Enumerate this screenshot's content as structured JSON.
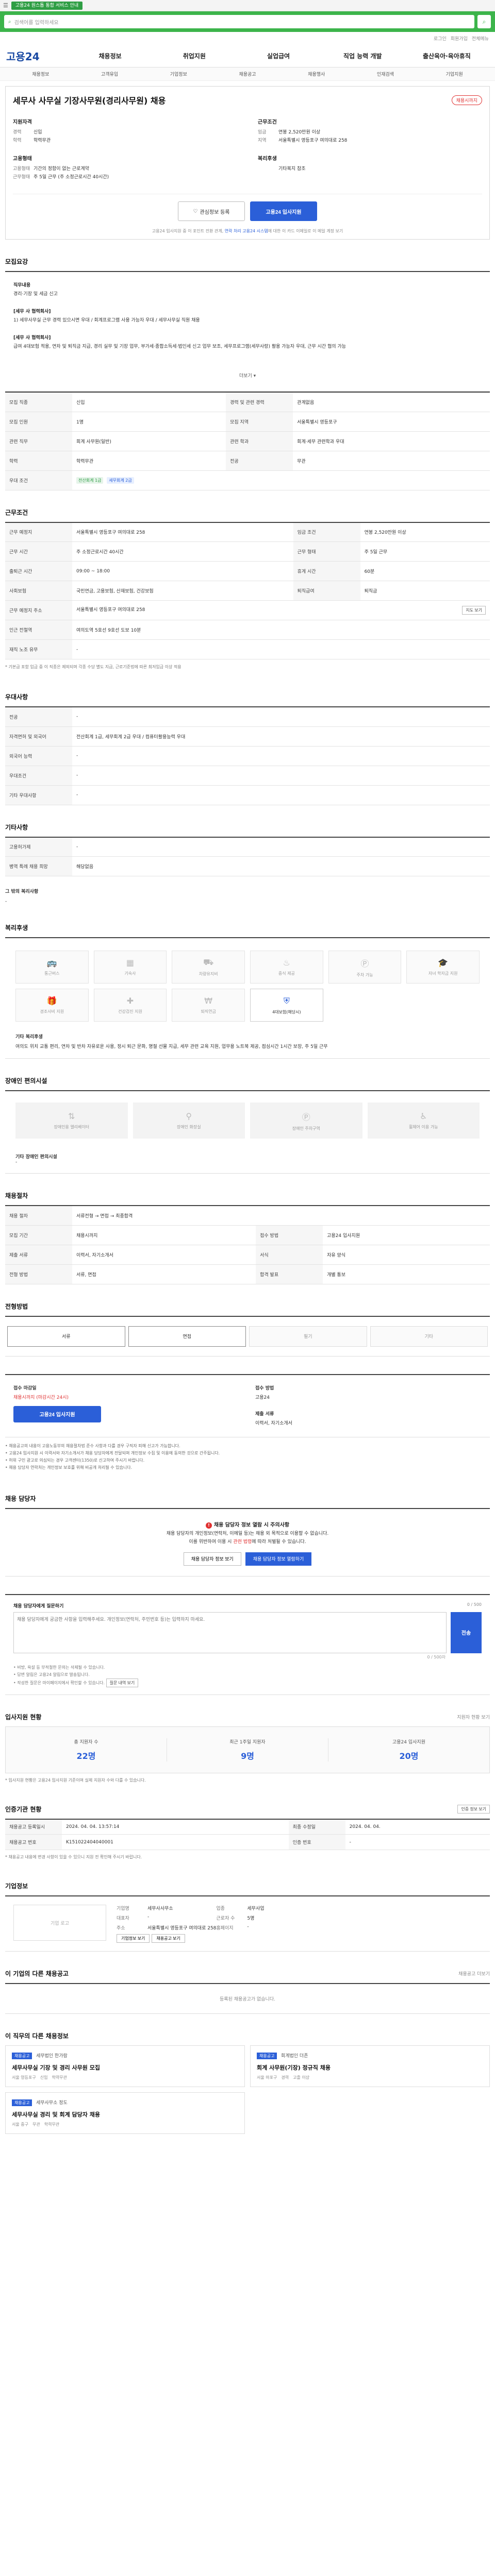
{
  "topbar": {
    "menu_icon": "menu-icon",
    "notice": "고용24 원스톱 통합 서비스 안내",
    "right": ""
  },
  "banner": {
    "search_placeholder": "검색어를 입력하세요",
    "search_icon": "search-icon"
  },
  "util": {
    "links": [
      "로그인",
      "회원가입",
      "전체메뉴"
    ]
  },
  "gnb": {
    "logo": "고용24",
    "items": [
      "채용정보",
      "취업지원",
      "실업급여",
      "직업 능력 개발",
      "출산육아·육아휴직"
    ]
  },
  "subnav": {
    "items": [
      "채용정보",
      "고객유입",
      "기업정보",
      "채용공고",
      "채용행사",
      "인재검색",
      "기업지원"
    ]
  },
  "job": {
    "title": "세무사 사무실 기장사무원(경리사무원) 채용",
    "badge": "채용시까지",
    "left": [
      {
        "title": "지원자격",
        "rows": [
          {
            "k": "경력",
            "v": "신입"
          },
          {
            "k": "학력",
            "v": "학력무관"
          }
        ]
      },
      {
        "title": "고용형태",
        "rows": [
          {
            "k": "고용형태",
            "v": "기간의 정함이 없는 근로계약"
          },
          {
            "k": "근무형태",
            "v": "주 5일 근무 (주 소정근로시간 40시간)"
          }
        ]
      }
    ],
    "right": [
      {
        "title": "근무조건",
        "rows": [
          {
            "k": "임금",
            "v": "연봉 2,520만원 이상"
          },
          {
            "k": "지역",
            "v": "서울특별시 영등포구 여의대로 258"
          }
        ]
      },
      {
        "title": "복리후생",
        "rows": [
          {
            "k": "",
            "v": "기타복지 참조"
          }
        ]
      }
    ],
    "save_label": "관심정보 등록",
    "apply_label": "고용24 입사지원",
    "note_prefix": "고용24 입사지원 중 이 포인트 전환 관계, ",
    "note_highlight": "연락 처리 고용24 시스템",
    "note_suffix": "에 대한 이 카드 이메일로 이 메일 계정 보기"
  },
  "detail": {
    "section_title": "모집요강",
    "blocks": [
      {
        "dt": "직무내용",
        "dd": "경리·기장 및 세금 신고"
      },
      {
        "dt": "[세무 사 협력회사]",
        "dd": "1) 세무사무실 근무 경력 있으시면 우대 / 회계프로그램 사용 가능자 우대 / 세무사무실 직원 채용"
      },
      {
        "dt": "[세무 사 협력회사]",
        "dd": "급여 4대보험 적용, 연차 및 퇴직금 지급, 경리 실무 및 기장 업무, 부가세·종합소득세·법인세 신고 업무 보조, 세무프로그램(세무사랑) 활용 가능자 우대, 근무 시간 협의 가능"
      }
    ],
    "more_label": "더보기 ▾",
    "table": [
      {
        "k": "모집 직종",
        "v": "신입",
        "k2": "경력 및 관련 경력",
        "v2": "관계없음"
      },
      {
        "k": "모집 인원",
        "v": "1명",
        "k2": "모집 지역",
        "v2": "서울특별시 영등포구"
      },
      {
        "k": "관련 직무",
        "v": "회계 사무원(일반)",
        "k2": "관련 학과",
        "v2": "회계·세무 관련학과 우대"
      },
      {
        "k": "학력",
        "v": "학력무관",
        "k2": "전공",
        "v2": "무관"
      }
    ],
    "tags_label": "우대 조건",
    "tags_green": "전산회계 1급",
    "tags_blue": "세무회계 2급"
  },
  "work": {
    "section_title": "근무조건",
    "rows": [
      {
        "k": "근무 예정지",
        "v": "서울특별시 영등포구 여의대로 258",
        "k2": "임금 조건",
        "v2": "연봉 2,520만원 이상"
      },
      {
        "k": "근무 시간",
        "v": "주 소정근로시간 40시간",
        "k2": "근무 형태",
        "v2": "주 5일 근무"
      },
      {
        "k": "출퇴근 시간",
        "v": "09:00 ~ 18:00",
        "k2": "휴게 시간",
        "v2": "60분"
      },
      {
        "k": "사회보험",
        "v": "국민연금, 고용보험, 산재보험, 건강보험",
        "k2": "퇴직급여",
        "v2": "퇴직금"
      },
      {
        "k": "근무 예정지 주소",
        "v": "서울특별시 영등포구 여의대로 258",
        "k2": "",
        "v2": ""
      },
      {
        "k": "인근 전철역",
        "v": "여의도역 5호선 9호선 도보 10분",
        "k2": "",
        "v2": ""
      },
      {
        "k": "재직 노조 유무",
        "v": "-",
        "k2": "",
        "v2": ""
      }
    ],
    "map_btn": "지도 보기",
    "footnote": "* 기본급 포함 임금 중 이 직종은 제외되며 각종 수당 별도 지급, 근로기준법에 따른 최저임금 이상 적용"
  },
  "apply_conditions": {
    "section_title": "우대사항",
    "rows": [
      {
        "k": "전공",
        "v": "-"
      },
      {
        "k": "자격면허 및 외국어",
        "v": "전산회계 1급, 세무회계 2급 우대 / 컴퓨터활용능력 우대"
      },
      {
        "k": "외국어 능력",
        "v": "-"
      },
      {
        "k": "우대조건",
        "v": "-"
      },
      {
        "k": "기타 우대사항",
        "v": "-"
      }
    ]
  },
  "other": {
    "section_title": "기타사항",
    "rows": [
      {
        "k": "고용허가제",
        "v": "-"
      },
      {
        "k": "병역 특례 채용 희망",
        "v": "해당없음"
      }
    ],
    "etc_title": "그 밖의 복리사항",
    "etc_text": "-"
  },
  "welfare": {
    "section_title": "복리후생",
    "items": [
      {
        "label": "통근버스",
        "icon": "bus-icon",
        "on": false
      },
      {
        "label": "기숙사",
        "icon": "building-icon",
        "on": false
      },
      {
        "label": "차량유지비",
        "icon": "car-icon",
        "on": false
      },
      {
        "label": "중식 제공",
        "icon": "meal-icon",
        "on": false
      },
      {
        "label": "주차 가능",
        "icon": "parking-icon",
        "on": false
      },
      {
        "label": "자녀 학자금 지원",
        "icon": "graduation-icon",
        "on": false
      },
      {
        "label": "경조사비 지원",
        "icon": "gift-icon",
        "on": false
      },
      {
        "label": "건강검진 지원",
        "icon": "health-icon",
        "on": false
      },
      {
        "label": "퇴직연금",
        "icon": "pension-icon",
        "on": false
      },
      {
        "label": "4대보험(해당시)",
        "icon": "shield-icon",
        "on": true
      }
    ],
    "sub_title": "기타 복리후생",
    "sub_text": "여의도 위치 교통 편리, 연차 및 반차 자유로운 사용, 정시 퇴근 문화, 명절 선물 지급, 세무 관련 교육 지원, 업무용 노트북 제공, 점심시간 1시간 보장, 주 5일 근무"
  },
  "access": {
    "section_title": "장애인 편의시설",
    "items": [
      {
        "label": "장애인용 엘리베이터",
        "icon": "elevator-icon"
      },
      {
        "label": "장애인 화장실",
        "icon": "restroom-icon"
      },
      {
        "label": "장애인 주차구역",
        "icon": "parking-icon"
      },
      {
        "label": "휠체어 이용 가능",
        "icon": "wheelchair-icon"
      }
    ],
    "sub_title": "기타 장애인 편의시설",
    "sub_text": "-"
  },
  "recruit": {
    "section_title": "채용절차",
    "rows": [
      {
        "k": "채용 절차",
        "v": "서류전형 → 면접 → 최종합격",
        "k2": "",
        "v2": ""
      },
      {
        "k": "모집 기간",
        "v": "채용시까지",
        "k2": "접수 방법",
        "v2": "고용24 입사지원"
      },
      {
        "k": "제출 서류",
        "v": "이력서, 자기소개서",
        "k2": "서식",
        "v2": "자유 양식"
      },
      {
        "k": "전형 방법",
        "v": "서류, 면접",
        "k2": "합격 발표",
        "v2": "개별 통보"
      }
    ]
  },
  "process": {
    "section_title": "전형방법",
    "items": [
      {
        "label": "서류",
        "on": true
      },
      {
        "label": "면접",
        "on": true
      },
      {
        "label": "필기",
        "on": false
      },
      {
        "label": "기타",
        "on": false
      }
    ]
  },
  "howto": {
    "col1_title": "접수 마감일",
    "col1_value": "채용시까지 (마감시간 24시)",
    "col1_btn": "고용24 입사지원",
    "col2_title": "접수 방법",
    "col2_value": "고용24",
    "col3_title": "제출 서류",
    "col3_value": "이력서, 자기소개서"
  },
  "notes": {
    "lines": [
      "• 채용공고의 내용이 고용노동부의 채용절차법 준수 사항과 다를 경우 구직자 피해 신고가 가능합니다.",
      "• 고용24 입사지원 시 이력서와 자기소개서가 채용 담당자에게 전달되며 개인정보 수집 및 이용에 동의한 것으로 간주됩니다.",
      "• 허위 구인 광고로 의심되는 경우 고객센터(1350)로 신고하여 주시기 바랍니다.",
      "• 채용 담당자 연락처는 개인정보 보호를 위해 비공개 처리될 수 있습니다."
    ]
  },
  "contact": {
    "section_title": "채용 담당자",
    "warn": "채용 담당자 정보 열람 시 주의사항",
    "line1": "채용 담당자의 개인정보(연락처, 이메일 등)는 채용 외 목적으로 이용할 수 없습니다.",
    "line2_prefix": "이를 위반하여 이용 시 ",
    "line2_red": "관련 법령",
    "line2_suffix": "에 따라 처벌될 수 있습니다.",
    "btn_view": "채용 담당자 정보 보기",
    "btn_apply": "채용 담당자 정보 열람하기"
  },
  "inquiry": {
    "title": "채용 담당자에게 질문하기",
    "side": "0 / 500",
    "placeholder": "채용 담당자에게 궁금한 사항을 입력해주세요. 개인정보(연락처, 주민번호 등)는 입력하지 마세요.",
    "btn": "전송",
    "count": "0 / 500자",
    "notes": [
      "• 비방, 욕설 등 부적절한 문의는 삭제될 수 있습니다.",
      "• 답변 알림은 고용24 알림으로 발송됩니다.",
      "• 작성한 질문은 마이페이지에서 확인할 수 있습니다."
    ],
    "notes_btn": "질문 내역 보기"
  },
  "status": {
    "section_title": "입사지원 현황",
    "side": "지원자 현황 보기",
    "items": [
      {
        "label_prefix": "총 지원자 수",
        "highlight": "",
        "value": "22명"
      },
      {
        "label_prefix": "최근 1주일 지원자 ",
        "highlight": "",
        "value": "9명"
      },
      {
        "label_prefix": "고용24 입사지원 ",
        "highlight": "",
        "value": "20명"
      }
    ],
    "note": "* 입사지원 현황은 고용24 입사지원 기준이며 실제 지원자 수와 다를 수 있습니다."
  },
  "history": {
    "section_title": "인증기관 현황",
    "side_btn": "인증 정보 보기",
    "rows": [
      {
        "k": "채용공고 등록일시",
        "v": "2024. 04. 04. 13:57:14",
        "k2": "최종 수정일",
        "v2": "2024. 04. 04."
      },
      {
        "k": "채용공고 번호",
        "v": "K151022404040001",
        "k2": "인증 번호",
        "v2": "-"
      }
    ],
    "note": "* 채용공고 내용에 변경 사항이 있을 수 있으니 지원 전 확인해 주시기 바랍니다."
  },
  "company": {
    "section_title": "기업정보",
    "logo": "기업 로고",
    "rows": [
      {
        "k": "기업명",
        "v": "세무사사무소",
        "k2": "업종",
        "v2": "세무사업"
      },
      {
        "k": "대표자",
        "v": "-",
        "k2": "근로자 수",
        "v2": "5명"
      },
      {
        "k": "주소",
        "v": "서울특별시 영등포구 여의대로 258",
        "k2": "홈페이지",
        "v2": "-"
      }
    ],
    "btn1": "기업정보 보기",
    "btn2": "채용공고 보기"
  },
  "same_company": {
    "section_title": "이 기업의 다른 채용공고",
    "side": "채용공고 더보기",
    "empty": "등록된 채용공고가 없습니다."
  },
  "related": {
    "section_title": "이 직무의 다른 채용정보",
    "cards": [
      {
        "badge": "채용공고",
        "company": "세무법인 한가람",
        "title": "세무사무실 기장 및 경리 사무원 모집",
        "meta": [
          "서울 영등포구",
          "신입",
          "학력무관"
        ]
      },
      {
        "badge": "채용공고",
        "company": "회계법인 더존",
        "title": "회계 사무원(기장) 정규직 채용",
        "meta": [
          "서울 마포구",
          "경력",
          "고졸 이상"
        ]
      },
      {
        "badge": "채용공고",
        "company": "세무사무소 정도",
        "title": "세무사무실 경리 및 회계 담당자 채용",
        "meta": [
          "서울 중구",
          "무관",
          "학력무관"
        ]
      }
    ]
  }
}
